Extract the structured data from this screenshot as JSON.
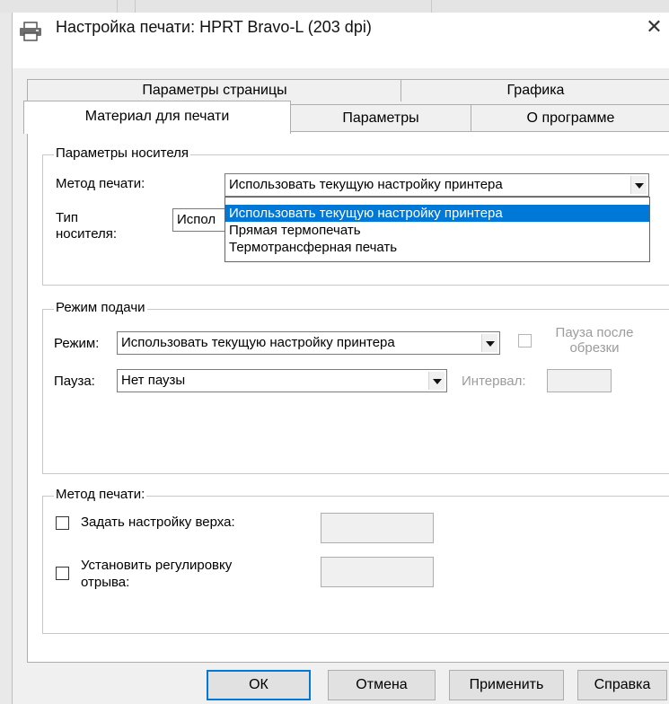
{
  "window": {
    "title": "Настройка печати: HPRT Bravo-L (203 dpi)",
    "close_label": "✕",
    "printer_icon": "printer-icon"
  },
  "tabs": {
    "row_back": [
      "Параметры страницы",
      "Графика"
    ],
    "row_front": [
      "Материал для печати",
      "Параметры",
      "О программе"
    ],
    "active": "Материал для печати"
  },
  "media_group": {
    "title": "Параметры носителя",
    "print_method_label": "Метод печати:",
    "print_method_value": "Использовать текущую настройку принтера",
    "media_type_label": "Тип\nносителя:",
    "media_type_value": "Испол",
    "dropdown_options": [
      "Использовать текущую настройку принтера",
      "Прямая термопечать",
      "Термотрансферная печать"
    ],
    "dropdown_selected_index": 0
  },
  "feed_group": {
    "title": "Режим подачи",
    "mode_label": "Режим:",
    "mode_value": "Использовать текущую настройку принтера",
    "pause_after_cut_label": "Пауза после обрезки",
    "pause_label": "Пауза:",
    "pause_value": "Нет паузы",
    "interval_label": "Интервал:",
    "interval_value": ""
  },
  "method_group": {
    "title": "Метод печати:",
    "set_top_label": "Задать настройку верха:",
    "set_top_value": "",
    "tear_adjust_label": "Установить регулировку\nотрыва:",
    "tear_adjust_value": ""
  },
  "buttons": {
    "ok": "ОК",
    "cancel": "Отмена",
    "apply": "Применить",
    "help": "Справка"
  },
  "colors": {
    "selection": "#0078d7",
    "default_button_border": "#0078d7",
    "disabled_text": "#9c9c9c"
  }
}
